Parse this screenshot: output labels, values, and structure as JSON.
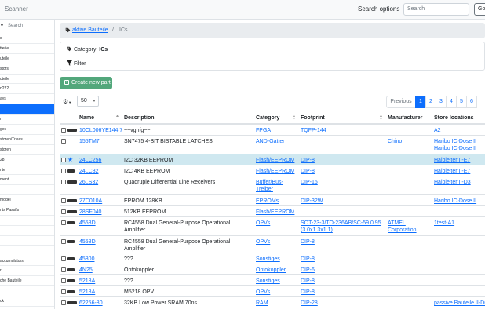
{
  "navbar": {
    "brand": "Scanner",
    "search_options_label": "Search options",
    "search_placeholder": "Search",
    "go_label": "Go"
  },
  "sidebar": {
    "search_placeholder": "Search",
    "items": [
      {
        "label": "s"
      },
      {
        "label": "tterie"
      },
      {
        "label": "uteile"
      },
      {
        "label": "stors"
      },
      {
        "label": "uteile"
      },
      {
        "label": "n222"
      },
      {
        "label": "ays"
      },
      {
        "label": "",
        "active": true
      },
      {
        "label": "n"
      },
      {
        "label": "ges"
      },
      {
        "label": "storen/Triacs"
      },
      {
        "label": "storen"
      },
      {
        "label": "28"
      },
      {
        "label": "nte"
      },
      {
        "label": "ment"
      },
      {
        "label": ""
      },
      {
        "label": " model"
      },
      {
        "label": "nts Passifs"
      },
      {
        "label": ""
      },
      {
        "label": ""
      },
      {
        "label": ""
      },
      {
        "label": ""
      },
      {
        "label": " accumulators"
      },
      {
        "label": "r"
      },
      {
        "label": "che Bauteile"
      },
      {
        "label": ""
      },
      {
        "label": "ck"
      }
    ]
  },
  "breadcrumb": {
    "parent": "aktive Bauteile",
    "separator": "/",
    "current": "ICs"
  },
  "filter": {
    "category_prefix": "Category:",
    "category_value": "ICs",
    "filter_label": "Filter"
  },
  "create_button": "Create new part",
  "table_controls": {
    "page_size": "50",
    "prev_label": "Previous",
    "pages": [
      "1",
      "2",
      "3",
      "4",
      "5",
      "6"
    ],
    "active_page": "1"
  },
  "columns": {
    "name": "Name",
    "description": "Description",
    "category": "Category",
    "footprint": "Footprint",
    "manufacturer": "Manufacturer",
    "store": "Store locations"
  },
  "rows": [
    {
      "chip": "long",
      "name": "10CL006YE144I7G",
      "description": "~~vghfg~~",
      "category": "FPGA",
      "footprint": "TQFP-144",
      "manufacturer": "",
      "store": "A2",
      "tall": false
    },
    {
      "chip": "",
      "name": "155TM7",
      "description": "SN7475 4-BIT BISTABLE LATCHES",
      "category": "AND-Gatter",
      "footprint": "",
      "manufacturer": "Chino",
      "store": "Haribo IC-Dose II",
      "tall": true,
      "store2": "Haribo IC-Dose II"
    },
    {
      "chip": "short",
      "name": "24LC256",
      "description": "I2C 32KB EEPROM",
      "category": "Flash/EEPROM",
      "footprint": "DIP-8",
      "manufacturer": "",
      "store": "Halbleiter II-E7",
      "tall": false,
      "selected": true,
      "star": true
    },
    {
      "chip": "short",
      "name": "24LC32",
      "description": "I2C 4KB EEPROM",
      "category": "Flash/EEPROM",
      "footprint": "DIP-8",
      "manufacturer": "",
      "store": "Halbleiter II-E7",
      "tall": false
    },
    {
      "chip": "long",
      "name": "26LS32",
      "description": "Quadruple Differential Line Receivers",
      "category": "Buffer/Bus-Treiber",
      "footprint": "DIP-16",
      "manufacturer": "",
      "store": "Halbleiter II-D3",
      "tall": true
    },
    {
      "chip": "long",
      "name": "27C010A",
      "description": "EPROM 128KB",
      "category": "EPROMs",
      "footprint": "DIP-32W",
      "manufacturer": "",
      "store": "Haribo IC-Dose II",
      "tall": false
    },
    {
      "chip": "long",
      "name": "28SF040",
      "description": "512KB EEPROM",
      "category": "Flash/EEPROM",
      "footprint": "",
      "manufacturer": "",
      "store": "",
      "tall": false
    },
    {
      "chip": "short",
      "name": "4558D",
      "description": "RC4558 Dual General-Purpose Operational Amplifier",
      "category": "OPVs",
      "footprint": "SOT-23-3/TO-236AB/SC-59 0.95 (3.0x1.3x1.1)",
      "manufacturer": "ATMEL Corporation",
      "store": "1test-A1",
      "tall": true
    },
    {
      "chip": "short",
      "name": "4558D",
      "description": "RC4558 Dual General-Purpose Operational Amplifier",
      "category": "OPVs",
      "footprint": "DIP-8",
      "manufacturer": "",
      "store": "",
      "tall": false
    },
    {
      "chip": "short",
      "name": "45800",
      "description": "???",
      "category": "Sonstiges",
      "footprint": "DIP-8",
      "manufacturer": "",
      "store": "",
      "tall": false
    },
    {
      "chip": "short",
      "name": "4N25",
      "description": "Optokoppler",
      "category": "Optokoppler",
      "footprint": "DIP-6",
      "manufacturer": "",
      "store": "",
      "tall": false
    },
    {
      "chip": "short",
      "name": "5218A",
      "description": "???",
      "category": "Sonstiges",
      "footprint": "DIP-8",
      "manufacturer": "",
      "store": "",
      "tall": false
    },
    {
      "chip": "short",
      "name": "5218A",
      "description": "M5218 OPV",
      "category": "OPVs",
      "footprint": "DIP-8",
      "manufacturer": "",
      "store": "",
      "tall": false
    },
    {
      "chip": "long",
      "name": "62256-80",
      "description": "32KB Low Power SRAM 70ns",
      "category": "RAM",
      "footprint": "DIP-28",
      "manufacturer": "",
      "store": "passive Bauteile II-D6",
      "tall": true
    }
  ]
}
